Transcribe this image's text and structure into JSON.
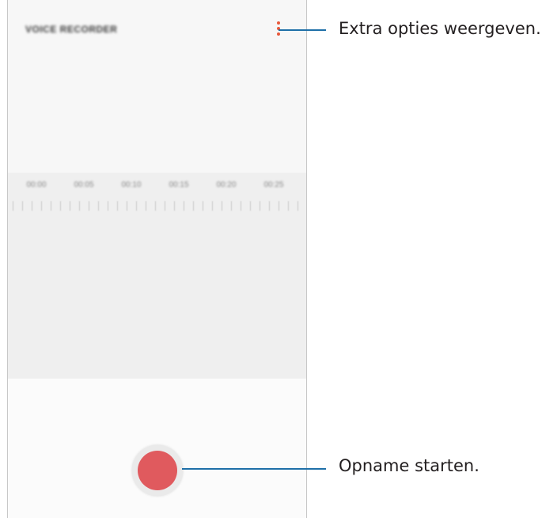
{
  "app": {
    "title": "VOICE RECORDER"
  },
  "header": {
    "more_options_icon": "more-vertical-icon"
  },
  "timeline": {
    "labels": [
      "00:00",
      "00:05",
      "00:10",
      "00:15",
      "00:20",
      "00:25"
    ]
  },
  "record": {
    "icon": "record-circle-icon"
  },
  "callouts": {
    "more_options": "Extra opties weergeven.",
    "start_recording": "Opname starten."
  },
  "colors": {
    "accent_dots": "#e8593c",
    "record_button": "#e05a5e",
    "callout_line": "#1e6fa8"
  }
}
